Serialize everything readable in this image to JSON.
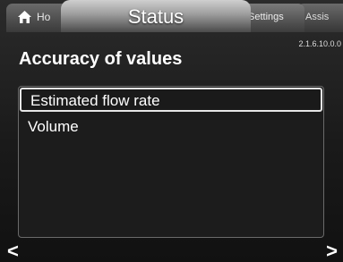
{
  "tabs": {
    "home": "Ho",
    "status": "Status",
    "settings": "Settings",
    "assist": "Assis"
  },
  "page": {
    "title": "Accuracy of values",
    "version": "2.1.6.10.0.0"
  },
  "list": {
    "items": [
      "Estimated flow rate",
      "Volume"
    ],
    "selected_index": 0
  },
  "nav": {
    "left": "<",
    "right": ">"
  },
  "icons": {
    "home": "home-icon"
  }
}
